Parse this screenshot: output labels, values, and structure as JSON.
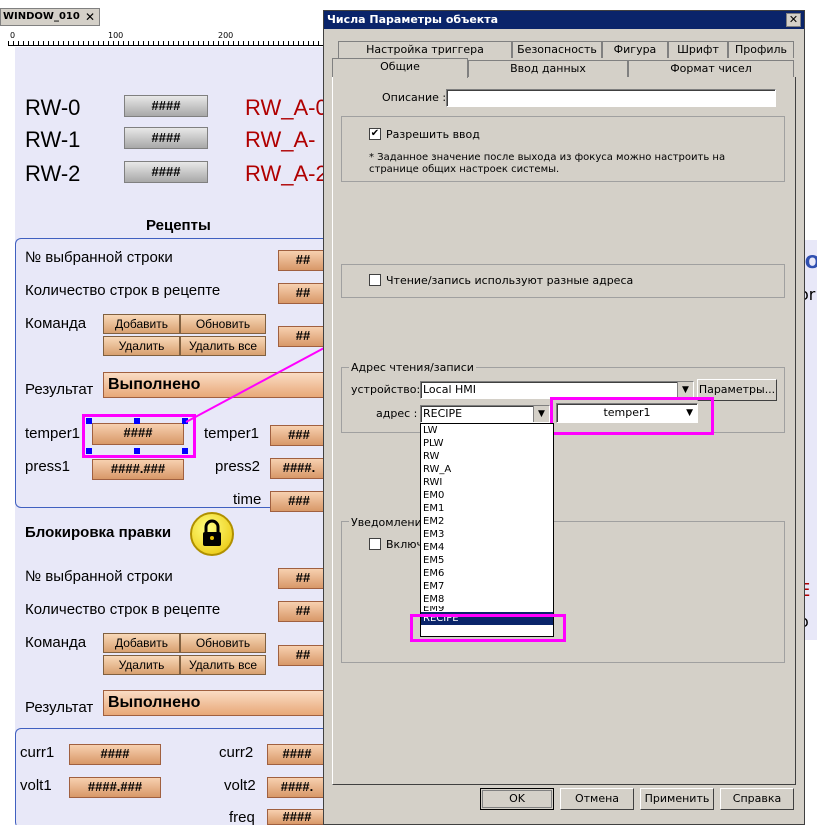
{
  "window_tab": {
    "label": "WINDOW_010",
    "close": "✕"
  },
  "ruler": {
    "marks": [
      "0",
      "100",
      "200"
    ]
  },
  "rw_rows": [
    {
      "label": "RW-0",
      "value": "####",
      "addr": "RW_A-0"
    },
    {
      "label": "RW-1",
      "value": "####",
      "addr": "RW_A-"
    },
    {
      "label": "RW-2",
      "value": "####",
      "addr": "RW_A-2"
    }
  ],
  "recipes": {
    "title": "Рецепты",
    "selected_row_label": "№ выбранной строки",
    "row_count_label": "Количество строк в рецепте",
    "command_label": "Команда",
    "buttons": {
      "add": "Добавить",
      "update": "Обновить",
      "delete": "Удалить",
      "delete_all": "Удалить все"
    },
    "result_label": "Результат",
    "result_value": "Выполнено",
    "hash": "##",
    "temper1_label": "temper1",
    "temper1_value": "####",
    "temper1_right_label": "temper1",
    "press1_label": "press1",
    "press1_value": "####.###",
    "press2_label": "press2",
    "press2_value": "####.",
    "time_label": "time",
    "temper1_right_value": "###",
    "time_value": "###"
  },
  "lock": {
    "title": "Блокировка правки",
    "selected_row_label": "№ выбранной строки",
    "row_count_label": "Количество строк в рецепте",
    "command_label": "Команда",
    "buttons": {
      "add": "Добавить",
      "update": "Обновить",
      "delete": "Удалить",
      "delete_all": "Удалить все"
    },
    "result_label": "Результат",
    "result_value": "Выполнено",
    "hash": "##",
    "curr1_label": "curr1",
    "curr1_value": "####",
    "curr2_label": "curr2",
    "curr2_value": "####",
    "volt1_label": "volt1",
    "volt1_value": "####.###",
    "volt2_label": "volt2",
    "volt2_value": "####.",
    "freq_label": "freq",
    "freq_value": "####"
  },
  "right_strip": {
    "texts": [
      "IO",
      "or",
      "E",
      "o"
    ]
  },
  "dialog": {
    "title": "Числа Параметры объекта",
    "close": "✕",
    "tabs_row1": [
      "Настройка  триггера действия",
      "Безопасность",
      "Фигура",
      "Шрифт",
      "Профиль"
    ],
    "tabs_row2": [
      "Общие",
      "Ввод данных",
      "Формат чисел"
    ],
    "description_label": "Описание :",
    "description_value": "",
    "allow_input_label": "Разрешить ввод",
    "allow_input_checked": "✔",
    "note": "* Заданное значение после выхода из фокуса можно настроить на странице общих настроек системы.",
    "diff_addr_label": "Чтение/запись используют разные адреса",
    "address_group": "Адрес чтения/записи",
    "device_label": "устройство:",
    "device_value": "Local HMI",
    "params_button": "Параметры...",
    "addr_label": "адрес :",
    "addr_value": "RECIPE",
    "addr_tag": "temper1",
    "addr_options": [
      "LW",
      "PLW",
      "RW",
      "RW_A",
      "RWI",
      "EM0",
      "EM1",
      "EM2",
      "EM3",
      "EM4",
      "EM5",
      "EM6",
      "EM7",
      "EM8",
      "EM9",
      "RECIPE"
    ],
    "notify_group": "Уведомления",
    "notify_checkbox_label": "Включ",
    "ok": "OK",
    "cancel": "Отмена",
    "apply": "Применить",
    "help": "Справка"
  }
}
